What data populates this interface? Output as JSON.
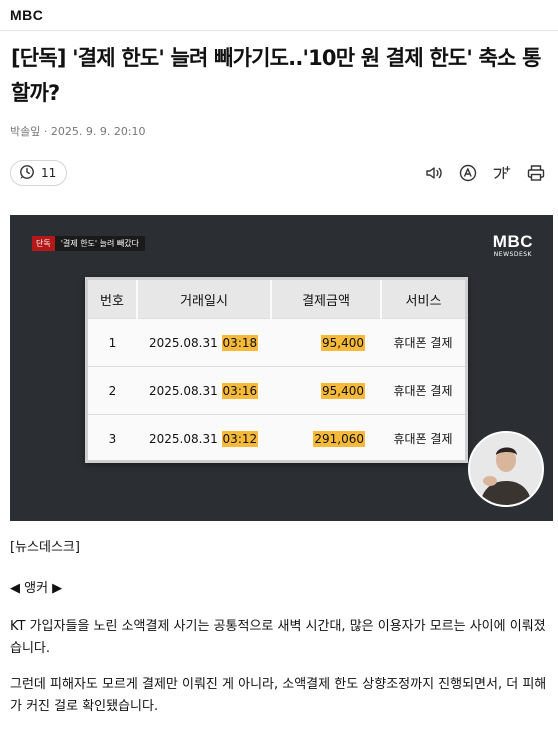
{
  "site": {
    "brand": "MBC"
  },
  "article": {
    "headline": "[단독] '결제 한도' 늘려 빼가기도..'10만 원 결제 한도' 축소 통할까?",
    "byline": "박솔잎 · 2025. 9. 9. 20:10",
    "comment_count": "11"
  },
  "toolbar_icons": [
    "speaker-icon",
    "translate-icon",
    "font-size-icon",
    "print-icon"
  ],
  "video": {
    "badge_exclusive": "단독",
    "badge_caption": "'결제 한도' 늘려 빼갔다",
    "logo": "MBC",
    "logo_sub": "NEWSDESK",
    "table": {
      "headers": [
        "번호",
        "거래일시",
        "결제금액",
        "서비스"
      ],
      "rows": [
        {
          "no": "1",
          "date": "2025.08.31",
          "time": "03:18",
          "amount": "95,400",
          "service": "휴대폰 결제"
        },
        {
          "no": "2",
          "date": "2025.08.31",
          "time": "03:16",
          "amount": "95,400",
          "service": "휴대폰 결제"
        },
        {
          "no": "3",
          "date": "2025.08.31",
          "time": "03:12",
          "amount": "291,060",
          "service": "휴대폰 결제"
        }
      ]
    }
  },
  "body": {
    "p1": "[뉴스데스크]",
    "p2": "◀ 앵커 ▶",
    "p3": "KT 가입자들을 노린 소액결제 사기는 공통적으로 새벽 시간대, 많은 이용자가 모르는 사이에 이뤄졌습니다.",
    "p4": "그런데 피해자도 모르게 결제만 이뤄진 게 아니라, 소액결제 한도 상향조정까지 진행되면서, 더 피해가 커진 걸로 확인됐습니다."
  },
  "colors": {
    "highlight": "#f7b93a",
    "badge_red": "#b41919",
    "video_bg": "#2b2e33"
  }
}
